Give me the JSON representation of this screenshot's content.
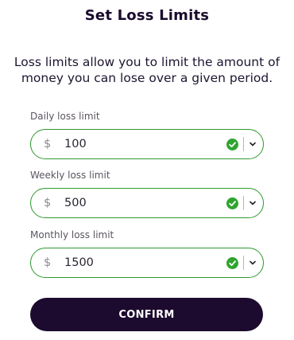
{
  "header": {
    "title": "Set Loss Limits"
  },
  "description": {
    "line1": "Loss limits allow you to limit the amount of",
    "line2": "money you can lose over a given period."
  },
  "fields": [
    {
      "label": "Daily loss limit",
      "currency": "$",
      "value": "100"
    },
    {
      "label": "Weekly loss limit",
      "currency": "$",
      "value": "500"
    },
    {
      "label": "Monthly loss limit",
      "currency": "$",
      "value": "1500"
    }
  ],
  "actions": {
    "confirm_label": "CONFIRM"
  },
  "colors": {
    "accent_border": "#2e9a2e",
    "check_green": "#2fa52f",
    "button_bg": "#1c0b2e"
  },
  "icons": {
    "valid": "check-circle-icon",
    "dropdown": "chevron-down-icon"
  }
}
